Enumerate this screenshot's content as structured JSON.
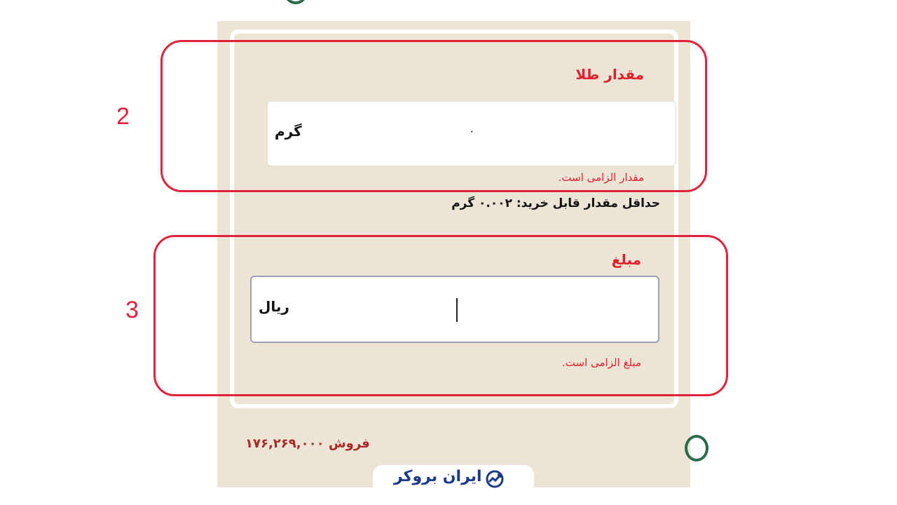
{
  "gold_field": {
    "label": "مقدار طلا",
    "unit": "گرم",
    "value": "۰",
    "error": "مقدار الزامی است."
  },
  "min_purchase_hint": "حداقل مقدار قابل خرید: ۰.۰۰۲ گرم",
  "amount_field": {
    "label": "مبلغ",
    "unit": "ریال",
    "value": "",
    "error": "مبلغ الزامی است."
  },
  "sell_price": "فروش ۱۷۶,۲۶۹,۰۰۰",
  "logo_text": "ایران بروکر",
  "annotations": {
    "first": "2",
    "second": "3"
  },
  "colors": {
    "accent_red": "#e0202e",
    "panel_bg": "#ece4d4",
    "logo_blue": "#1d3a8a",
    "brand_green": "#2a6b4a"
  }
}
